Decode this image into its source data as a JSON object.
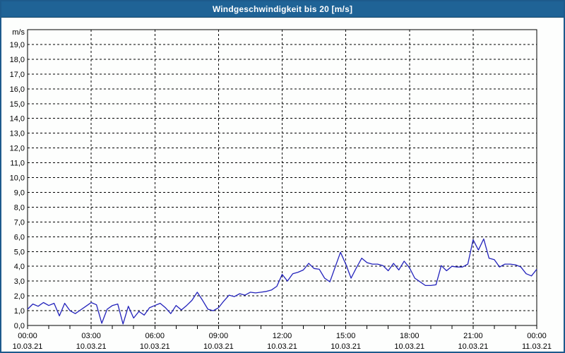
{
  "window": {
    "title": "Windgeschwindigkeit bis 20 [m/s]"
  },
  "colors": {
    "titlebar_bg": "#1f6396",
    "window_border": "#1d5a8c",
    "background": "#fdfefd",
    "title_text": "#ffffff",
    "axis": "#000000",
    "grid": "#000000",
    "tick_label": "#000000",
    "line": "#2222bb"
  },
  "chart_data": {
    "type": "line",
    "title": "Windgeschwindigkeit bis 20 [m/s]",
    "xlabel": "",
    "ylabel": "m/s",
    "ylim": [
      0,
      20
    ],
    "y_tick_step": 1.0,
    "y_tick_labels": [
      "0,0",
      "1,0",
      "2,0",
      "3,0",
      "4,0",
      "5,0",
      "6,0",
      "7,0",
      "8,0",
      "9,0",
      "10,0",
      "11,0",
      "12,0",
      "13,0",
      "14,0",
      "15,0",
      "16,0",
      "17,0",
      "18,0",
      "19,0"
    ],
    "xlim_hours": [
      0,
      24
    ],
    "x_minor_tick_every_hours": 1,
    "x_major_ticks": [
      {
        "hour": 0,
        "time": "00:00",
        "date": "10.03.21"
      },
      {
        "hour": 3,
        "time": "03:00",
        "date": "10.03.21"
      },
      {
        "hour": 6,
        "time": "06:00",
        "date": "10.03.21"
      },
      {
        "hour": 9,
        "time": "09:00",
        "date": "10.03.21"
      },
      {
        "hour": 12,
        "time": "12:00",
        "date": "10.03.21"
      },
      {
        "hour": 15,
        "time": "15:00",
        "date": "10.03.21"
      },
      {
        "hour": 18,
        "time": "18:00",
        "date": "10.03.21"
      },
      {
        "hour": 21,
        "time": "21:00",
        "date": "10.03.21"
      },
      {
        "hour": 24,
        "time": "00:00",
        "date": "11.03.21"
      }
    ],
    "grid": true,
    "legend": "none",
    "x_start_hour": 0,
    "x_step_hours": 0.25,
    "series": [
      {
        "name": "Windgeschwindigkeit",
        "unit": "m/s",
        "values": [
          1.1,
          1.45,
          1.3,
          1.55,
          1.35,
          1.5,
          0.65,
          1.5,
          1.0,
          0.8,
          1.05,
          1.3,
          1.55,
          1.4,
          0.15,
          1.1,
          1.35,
          1.45,
          0.1,
          1.3,
          0.5,
          0.95,
          0.7,
          1.2,
          1.35,
          1.5,
          1.2,
          0.8,
          1.35,
          1.05,
          1.35,
          1.7,
          2.25,
          1.7,
          1.1,
          1.0,
          1.2,
          1.65,
          2.05,
          1.95,
          2.15,
          2.05,
          2.25,
          2.2,
          2.25,
          2.3,
          2.4,
          2.65,
          3.45,
          3.0,
          3.5,
          3.6,
          3.75,
          4.2,
          3.85,
          3.8,
          3.2,
          2.95,
          3.95,
          4.95,
          4.15,
          3.2,
          3.9,
          4.55,
          4.25,
          4.15,
          4.15,
          4.05,
          3.7,
          4.2,
          3.75,
          4.35,
          3.9,
          3.2,
          2.95,
          2.7,
          2.7,
          2.75,
          4.05,
          3.7,
          4.0,
          3.95,
          3.95,
          4.15,
          5.8,
          5.1,
          5.85,
          4.55,
          4.45,
          3.95,
          4.15,
          4.15,
          4.1,
          3.95,
          3.5,
          3.35,
          3.8
        ]
      }
    ]
  }
}
